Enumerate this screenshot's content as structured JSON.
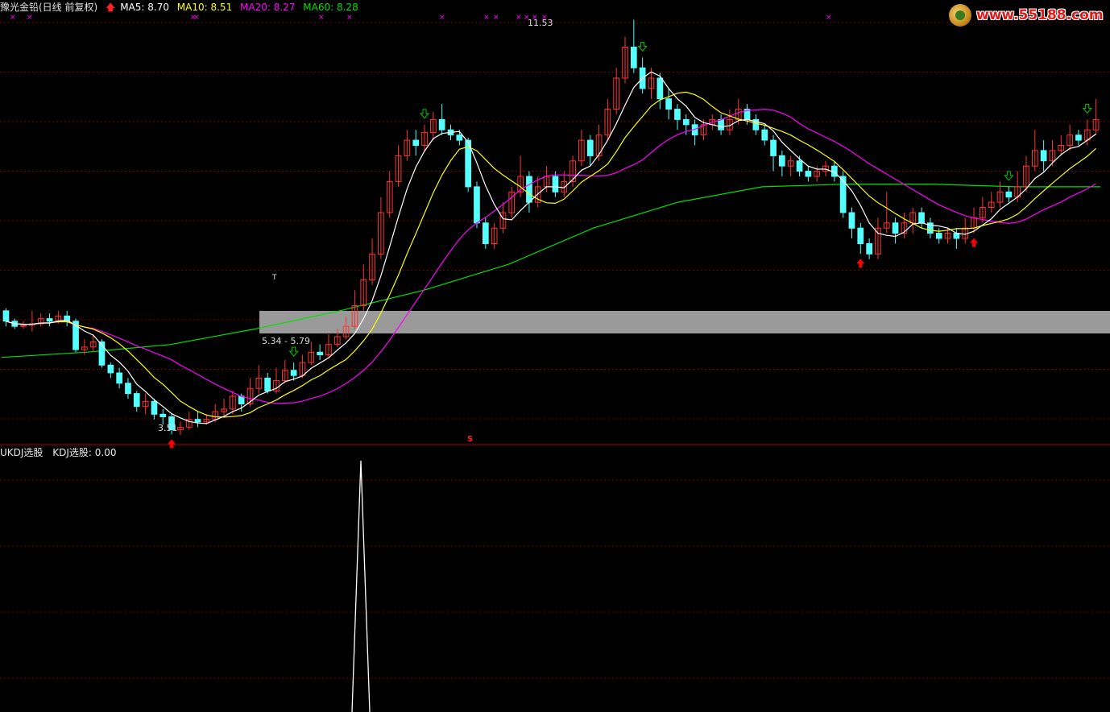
{
  "header": {
    "stock_name": "豫光金铅(日线 前复权)",
    "ma5": "MA5: 8.70",
    "ma10": "MA10: 8.51",
    "ma20": "MA20: 8.27",
    "ma60": "MA60: 8.28"
  },
  "indicator": {
    "name": "UKDJ选股",
    "value_label": "KDJ选股: 0.00"
  },
  "annotations": {
    "high_price": "11.53",
    "low_price": "3.51",
    "band_range": "5.34 - 5.79",
    "s_marker": "S",
    "t_marker": "T"
  },
  "watermark": {
    "text": "www.55188.com"
  },
  "colors": {
    "background": "#000000",
    "up_candle": "#ff3232",
    "down_candle": "#54ffff",
    "ma5": "#ffffff",
    "ma10": "#ffff00",
    "ma20": "#ff00ff",
    "ma60": "#00e000",
    "gridline": "#7a0000",
    "buy_arrow": "#ff0000",
    "sell_arrow": "#00c800",
    "band": "#9a9a9a"
  },
  "chart_data": {
    "type": "candlestick",
    "price_range": {
      "min": 3.5,
      "max": 11.6
    },
    "labels": {
      "highest": 11.53,
      "lowest": 3.51,
      "band_low": 5.34,
      "band_high": 5.79
    },
    "candles": [
      [
        5.9,
        5.7,
        5.95,
        5.6
      ],
      [
        5.7,
        5.6,
        5.75,
        5.55
      ],
      [
        5.6,
        5.62,
        5.7,
        5.55
      ],
      [
        5.62,
        5.65,
        5.9,
        5.5
      ],
      [
        5.65,
        5.75,
        5.85,
        5.6
      ],
      [
        5.75,
        5.7,
        5.85,
        5.6
      ],
      [
        5.7,
        5.8,
        5.9,
        5.65
      ],
      [
        5.8,
        5.7,
        5.9,
        5.6
      ],
      [
        5.7,
        5.15,
        5.75,
        5.1
      ],
      [
        5.15,
        5.2,
        5.35,
        5.05
      ],
      [
        5.2,
        5.3,
        5.45,
        5.1
      ],
      [
        5.3,
        4.85,
        5.35,
        4.8
      ],
      [
        4.85,
        4.7,
        4.9,
        4.6
      ],
      [
        4.7,
        4.5,
        4.8,
        4.4
      ],
      [
        4.5,
        4.3,
        4.6,
        4.2
      ],
      [
        4.3,
        4.05,
        4.35,
        3.95
      ],
      [
        4.05,
        4.15,
        4.3,
        3.9
      ],
      [
        4.15,
        3.9,
        4.2,
        3.8
      ],
      [
        3.9,
        3.85,
        4.0,
        3.7
      ],
      [
        3.85,
        3.6,
        3.9,
        3.51
      ],
      [
        3.6,
        3.65,
        3.75,
        3.5
      ],
      [
        3.65,
        3.8,
        3.95,
        3.6
      ],
      [
        3.8,
        3.75,
        3.95,
        3.65
      ],
      [
        3.75,
        3.8,
        3.9,
        3.7
      ],
      [
        3.8,
        3.95,
        4.1,
        3.75
      ],
      [
        3.95,
        4.0,
        4.2,
        3.85
      ],
      [
        4.0,
        4.25,
        4.35,
        3.9
      ],
      [
        4.25,
        4.1,
        4.3,
        3.95
      ],
      [
        4.1,
        4.4,
        4.6,
        4.05
      ],
      [
        4.4,
        4.6,
        4.85,
        4.3
      ],
      [
        4.6,
        4.35,
        4.7,
        4.3
      ],
      [
        4.35,
        4.55,
        4.8,
        4.3
      ],
      [
        4.55,
        4.75,
        4.95,
        4.5
      ],
      [
        4.75,
        4.65,
        4.9,
        4.55
      ],
      [
        4.65,
        4.9,
        5.05,
        4.6
      ],
      [
        4.9,
        5.1,
        5.3,
        4.85
      ],
      [
        5.1,
        5.05,
        5.25,
        4.95
      ],
      [
        5.05,
        5.25,
        5.45,
        5.0
      ],
      [
        5.25,
        5.4,
        5.55,
        5.2
      ],
      [
        5.4,
        5.6,
        5.8,
        5.35
      ],
      [
        5.6,
        6.0,
        6.3,
        5.55
      ],
      [
        6.0,
        6.5,
        6.8,
        5.9
      ],
      [
        6.5,
        7.0,
        7.3,
        6.4
      ],
      [
        7.0,
        7.8,
        8.1,
        6.9
      ],
      [
        7.8,
        8.4,
        8.6,
        7.7
      ],
      [
        8.4,
        8.9,
        9.1,
        8.3
      ],
      [
        8.9,
        9.2,
        9.4,
        8.8
      ],
      [
        9.2,
        9.1,
        9.4,
        8.9
      ],
      [
        9.1,
        9.35,
        9.5,
        9.0
      ],
      [
        9.35,
        9.6,
        9.75,
        9.2
      ],
      [
        9.6,
        9.4,
        9.9,
        9.3
      ],
      [
        9.4,
        9.3,
        9.5,
        9.2
      ],
      [
        9.3,
        9.2,
        9.4,
        9.1
      ],
      [
        9.2,
        8.3,
        9.25,
        8.2
      ],
      [
        8.3,
        7.6,
        8.4,
        7.5
      ],
      [
        7.6,
        7.2,
        7.7,
        7.1
      ],
      [
        7.2,
        7.5,
        7.6,
        7.1
      ],
      [
        7.5,
        7.8,
        8.0,
        7.4
      ],
      [
        7.8,
        8.2,
        8.3,
        7.7
      ],
      [
        8.2,
        8.5,
        8.9,
        8.1
      ],
      [
        8.5,
        8.0,
        8.6,
        7.8
      ],
      [
        8.0,
        8.3,
        8.5,
        7.9
      ],
      [
        8.3,
        8.5,
        8.7,
        8.2
      ],
      [
        8.5,
        8.2,
        8.6,
        8.1
      ],
      [
        8.2,
        8.4,
        8.6,
        8.1
      ],
      [
        8.4,
        8.8,
        8.9,
        8.3
      ],
      [
        8.8,
        9.2,
        9.4,
        8.7
      ],
      [
        9.2,
        8.9,
        9.3,
        8.7
      ],
      [
        8.9,
        9.3,
        9.5,
        8.8
      ],
      [
        9.3,
        9.8,
        10.0,
        9.2
      ],
      [
        9.8,
        10.4,
        10.6,
        9.7
      ],
      [
        10.4,
        11.0,
        11.2,
        10.3
      ],
      [
        11.0,
        10.6,
        11.53,
        10.5
      ],
      [
        10.6,
        10.2,
        10.8,
        10.1
      ],
      [
        10.2,
        10.4,
        10.6,
        10.0
      ],
      [
        10.4,
        10.0,
        10.5,
        9.8
      ],
      [
        10.0,
        9.8,
        10.2,
        9.6
      ],
      [
        9.8,
        9.6,
        9.9,
        9.4
      ],
      [
        9.6,
        9.5,
        9.7,
        9.3
      ],
      [
        9.5,
        9.3,
        9.6,
        9.1
      ],
      [
        9.3,
        9.5,
        9.6,
        9.2
      ],
      [
        9.5,
        9.6,
        9.7,
        9.4
      ],
      [
        9.6,
        9.4,
        9.7,
        9.3
      ],
      [
        9.4,
        9.6,
        9.8,
        9.3
      ],
      [
        9.6,
        9.8,
        10.0,
        9.5
      ],
      [
        9.8,
        9.6,
        9.9,
        9.5
      ],
      [
        9.6,
        9.4,
        9.7,
        9.3
      ],
      [
        9.4,
        9.2,
        9.5,
        9.1
      ],
      [
        9.2,
        8.9,
        9.3,
        8.6
      ],
      [
        8.9,
        8.7,
        9.0,
        8.5
      ],
      [
        8.7,
        8.8,
        8.9,
        8.5
      ],
      [
        8.8,
        8.6,
        8.9,
        8.5
      ],
      [
        8.6,
        8.5,
        8.7,
        8.4
      ],
      [
        8.5,
        8.6,
        8.7,
        8.4
      ],
      [
        8.6,
        8.7,
        8.8,
        8.5
      ],
      [
        8.7,
        8.5,
        8.8,
        8.4
      ],
      [
        8.5,
        7.8,
        8.6,
        7.7
      ],
      [
        7.8,
        7.5,
        7.9,
        7.3
      ],
      [
        7.5,
        7.2,
        7.6,
        7.0
      ],
      [
        7.2,
        7.0,
        7.3,
        6.9
      ],
      [
        7.0,
        7.5,
        7.7,
        6.9
      ],
      [
        7.5,
        7.6,
        8.2,
        7.4
      ],
      [
        7.6,
        7.4,
        7.7,
        7.2
      ],
      [
        7.4,
        7.6,
        7.8,
        7.3
      ],
      [
        7.6,
        7.8,
        7.9,
        7.4
      ],
      [
        7.8,
        7.6,
        7.9,
        7.5
      ],
      [
        7.6,
        7.4,
        7.7,
        7.3
      ],
      [
        7.4,
        7.3,
        7.5,
        7.2
      ],
      [
        7.3,
        7.4,
        7.5,
        7.2
      ],
      [
        7.4,
        7.3,
        7.5,
        7.1
      ],
      [
        7.3,
        7.5,
        7.7,
        7.2
      ],
      [
        7.5,
        7.7,
        7.9,
        7.4
      ],
      [
        7.7,
        7.9,
        8.1,
        7.6
      ],
      [
        7.9,
        8.0,
        8.2,
        7.8
      ],
      [
        8.0,
        8.2,
        8.4,
        7.9
      ],
      [
        8.2,
        8.1,
        8.3,
        8.0
      ],
      [
        8.1,
        8.3,
        8.6,
        8.0
      ],
      [
        8.3,
        8.7,
        8.9,
        8.2
      ],
      [
        8.7,
        9.0,
        9.4,
        8.6
      ],
      [
        9.0,
        8.8,
        9.2,
        8.6
      ],
      [
        8.8,
        9.0,
        9.2,
        8.7
      ],
      [
        9.0,
        9.1,
        9.3,
        8.9
      ],
      [
        9.1,
        9.3,
        9.5,
        9.0
      ],
      [
        9.3,
        9.2,
        9.4,
        9.1
      ],
      [
        9.2,
        9.4,
        9.6,
        9.1
      ],
      [
        9.4,
        9.6,
        10.0,
        9.3
      ]
    ],
    "ma60": [
      5.0,
      5.1,
      5.25,
      5.55,
      5.9,
      6.3,
      6.8,
      7.5,
      8.0,
      8.3,
      8.35,
      8.35,
      8.3,
      8.3
    ],
    "band": {
      "low": 5.34,
      "high": 5.79
    },
    "kdj_signal": {
      "spike_index": 55,
      "baseline": 0.0,
      "peak": 100
    }
  }
}
